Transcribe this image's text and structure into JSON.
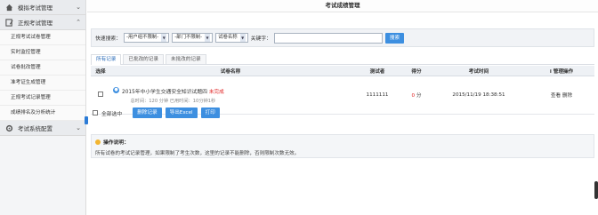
{
  "sidebar": {
    "sections": [
      {
        "label": "模拟考试管理",
        "icon": "home-icon",
        "expanded": false
      },
      {
        "label": "正规考试管理",
        "icon": "document-edit-icon",
        "expanded": true
      }
    ],
    "items": [
      "正规考试试卷管理",
      "实时监控管理",
      "试卷批改管理",
      "准考证生成管理",
      "正规考试记录管理",
      "成绩排名及分析统计"
    ],
    "config_section": {
      "label": "考试系统配置",
      "icon": "gear-icon"
    }
  },
  "page": {
    "title": "考试成绩管理"
  },
  "filter": {
    "label": "快速搜索：",
    "selects": [
      "-用户组不限制-",
      "-部门不限制-",
      "试卷名称"
    ],
    "keyword_label": "关键字：",
    "keyword_value": "",
    "search_button": "搜索"
  },
  "tabs": [
    "所有记录",
    "已批改的记录",
    "未批改的记录"
  ],
  "table": {
    "headers": {
      "select": "选择",
      "name": "试卷名称",
      "tester": "测试者",
      "score": "得分",
      "time": "考试时间",
      "ops": "管理操作",
      "ops_icon": "i"
    },
    "rows": [
      {
        "title": "2015年中小学生交通安全知识试题四",
        "status": "未完成",
        "meta": "总时间：120 分钟  已用时间：10分钟1秒",
        "tester": "1111111",
        "score": "0",
        "score_unit": "分",
        "time": "2015/11/19 18:38:51",
        "view": "查看",
        "delete": "删除"
      }
    ]
  },
  "bulk": {
    "select_all": "全部选中",
    "delete_button": "删除记录",
    "export_button": "导出Excel",
    "print_button": "打印"
  },
  "notice": {
    "title": "操作说明：",
    "text": "所有试卷的考试记录管理，如果限制了考生次数，这里的记录不能删除，否则限制次数无效。"
  },
  "colors": {
    "accent": "#3d8fe0",
    "danger": "#e02020"
  }
}
